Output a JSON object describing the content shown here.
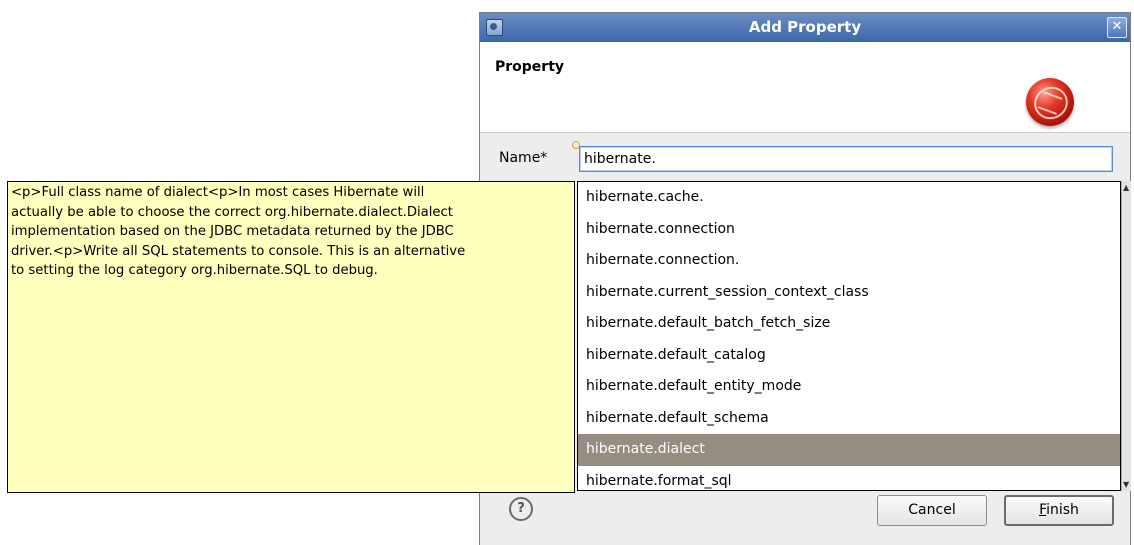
{
  "dialog": {
    "title": "Add Property",
    "header_title": "Property",
    "name_label": "Name*",
    "name_value": "hibernate.",
    "buttons": {
      "help": "?",
      "cancel": "Cancel",
      "finish_mnemonic": "F",
      "finish_rest": "inish"
    }
  },
  "tooltip": {
    "text": "<p>Full class name of dialect<p>In most cases Hibernate will\nactually be able to choose the correct org.hibernate.dialect.Dialect\nimplementation based on the JDBC metadata returned by the JDBC\ndriver.<p>Write all SQL statements to console. This is an alternative\nto setting the log category org.hibernate.SQL to debug."
  },
  "proposals": [
    "hibernate.cache.",
    "hibernate.connection",
    "hibernate.connection.",
    "hibernate.current_session_context_class",
    "hibernate.default_batch_fetch_size",
    "hibernate.default_catalog",
    "hibernate.default_entity_mode",
    "hibernate.default_schema",
    "hibernate.dialect",
    "hibernate.format_sql"
  ],
  "selected_proposal": "hibernate.dialect",
  "icons": {
    "window": "eclipse-app-icon",
    "close": "close-icon",
    "logo": "hibernate-logo",
    "required": "content-assist-bulb-icon",
    "help": "help-icon"
  },
  "colors": {
    "titlebar": "#3c67a8",
    "tooltip_bg": "#ffffbe",
    "selection": "#968d82"
  }
}
